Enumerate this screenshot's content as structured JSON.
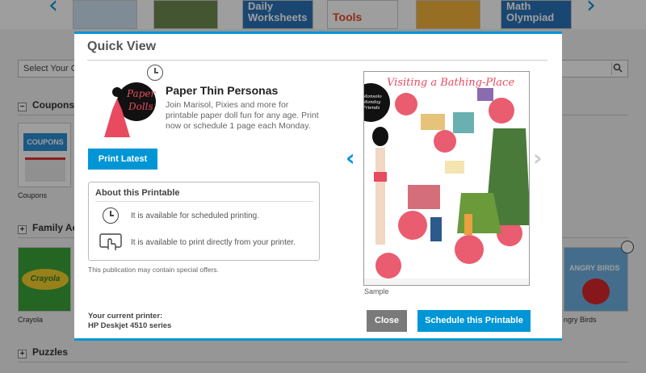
{
  "background": {
    "carousel_items": [
      "Daily Worksheets",
      "Tools",
      "Math Olympiad"
    ],
    "select_placeholder": "Select Your Ca",
    "sections": [
      {
        "label": "Coupons",
        "toggle": "−"
      },
      {
        "label": "Family Act",
        "toggle": "+"
      },
      {
        "label": "Puzzles",
        "toggle": "+"
      }
    ],
    "thumb_captions": [
      "Coupons",
      "Crayola",
      "ngry Birds"
    ],
    "coupons_thumb_text": "COUPONS",
    "crayola_thumb_text": "Crayola",
    "angry_birds_thumb_text": "ANGRY BIRDS"
  },
  "modal": {
    "title": "Quick View",
    "publication": {
      "title": "Paper Thin Personas",
      "description": "Join Marisol, Pixies and more for printable paper doll fun for any age. Print now or schedule 1 page each Monday.",
      "logo_text": "Paper Dolls"
    },
    "print_latest_label": "Print Latest",
    "about": {
      "title": "About this Printable",
      "rows": [
        {
          "icon": "clock-icon",
          "text": "It is available for scheduled printing."
        },
        {
          "icon": "touch-print-icon",
          "text": "It is available to print directly from your printer."
        }
      ]
    },
    "special_note": "This publication may contain special offers.",
    "printer": {
      "label": "Your current printer:",
      "name": "HP Deskjet 4510 series"
    },
    "sample": {
      "label": "Sample",
      "heading": "Visiting a Bathing-Place",
      "badge": "Monsolo Monday Friends"
    },
    "close_label": "Close",
    "schedule_label": "Schedule this Printable"
  },
  "colors": {
    "accent": "#0096d6",
    "close_button": "#7a7a7a",
    "overlay": "rgba(0,0,0,0.38)"
  }
}
